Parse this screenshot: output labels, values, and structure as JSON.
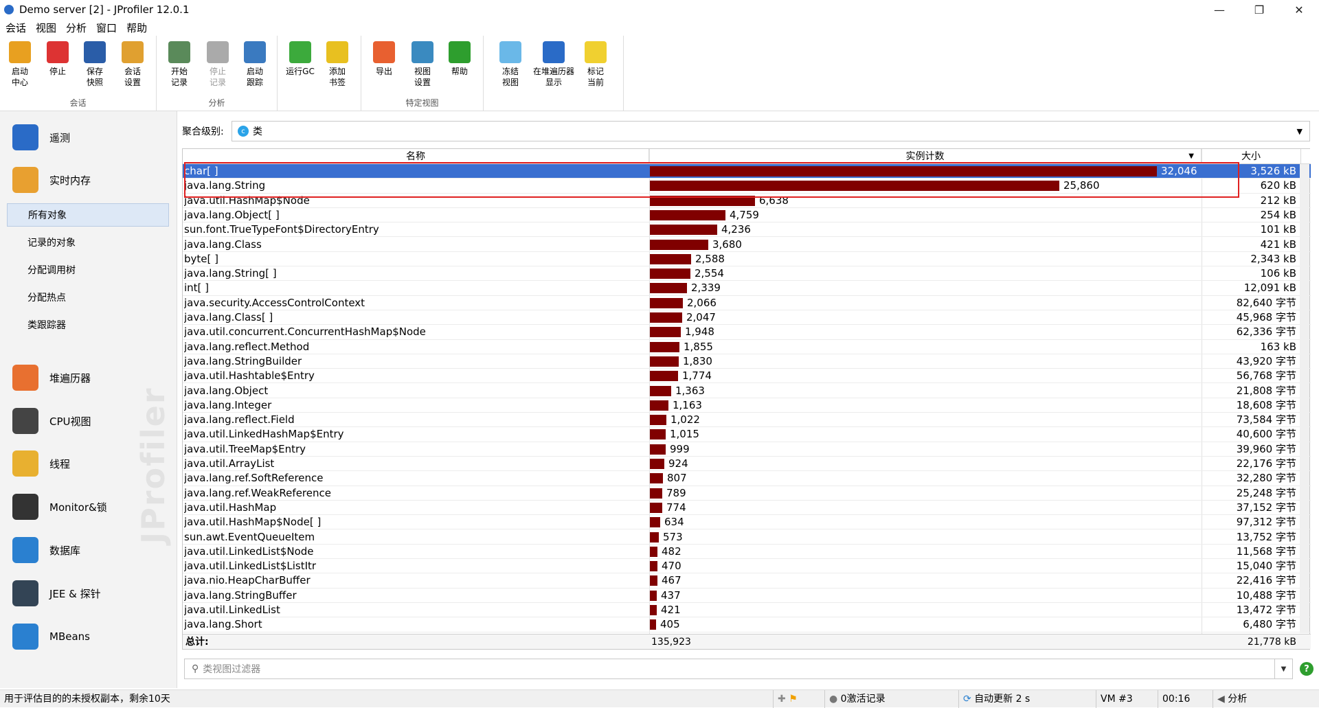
{
  "window": {
    "title": "Demo server [2] - JProfiler 12.0.1"
  },
  "menu": [
    "会话",
    "视图",
    "分析",
    "窗口",
    "帮助"
  ],
  "toolbar": {
    "groups": [
      {
        "label": "会话",
        "buttons": [
          {
            "label": "启动\n中心",
            "icon": "start-center-icon",
            "color": "#e8a020"
          },
          {
            "label": "停止",
            "icon": "stop-icon",
            "color": "#d33"
          },
          {
            "label": "保存\n快照",
            "icon": "save-snapshot-icon",
            "color": "#2a5da8"
          },
          {
            "label": "会话\n设置",
            "icon": "session-settings-icon",
            "color": "#e0a030"
          }
        ]
      },
      {
        "label": "分析",
        "buttons": [
          {
            "label": "开始\n记录",
            "icon": "start-recording-icon",
            "color": "#5a8a5a"
          },
          {
            "label": "停止\n记录",
            "icon": "stop-recording-icon",
            "color": "#aaa"
          },
          {
            "label": "启动\n跟踪",
            "icon": "start-tracking-icon",
            "color": "#3a7ac0"
          }
        ]
      },
      {
        "label": "",
        "buttons": [
          {
            "label": "运行GC",
            "icon": "run-gc-icon",
            "color": "#3caa3c"
          },
          {
            "label": "添加\n书签",
            "icon": "add-bookmark-icon",
            "color": "#e8c020"
          }
        ]
      },
      {
        "label": "特定视图",
        "buttons": [
          {
            "label": "导出",
            "icon": "export-icon",
            "color": "#e86030"
          },
          {
            "label": "视图\n设置",
            "icon": "view-settings-icon",
            "color": "#3a8ac0"
          },
          {
            "label": "帮助",
            "icon": "help-icon",
            "color": "#2e9e2e"
          }
        ]
      },
      {
        "label": "",
        "buttons": [
          {
            "label": "冻结\n视图",
            "icon": "freeze-view-icon",
            "color": "#6ab8e8"
          },
          {
            "label": "在堆遍历器\n显示",
            "icon": "show-in-heap-walker-icon",
            "color": "#2a6bc7"
          },
          {
            "label": "标记\n当前",
            "icon": "mark-current-icon",
            "color": "#f0d030"
          }
        ]
      }
    ]
  },
  "sidebar": {
    "sections": [
      {
        "label": "遥测",
        "icon": "telemetry-icon",
        "color": "#2a6bc7"
      },
      {
        "label": "实时内存",
        "icon": "live-memory-icon",
        "color": "#e8a030"
      },
      {
        "label": "堆遍历器",
        "icon": "heap-walker-icon",
        "color": "#e87030"
      },
      {
        "label": "CPU视图",
        "icon": "cpu-view-icon",
        "color": "#444"
      },
      {
        "label": "线程",
        "icon": "threads-icon",
        "color": "#e8b030"
      },
      {
        "label": "Monitor&锁",
        "icon": "monitor-lock-icon",
        "color": "#333"
      },
      {
        "label": "数据库",
        "icon": "database-icon",
        "color": "#2a80d0"
      },
      {
        "label": "JEE & 探针",
        "icon": "jee-probes-icon",
        "color": "#345"
      },
      {
        "label": "MBeans",
        "icon": "mbeans-icon",
        "color": "#2a80d0"
      }
    ],
    "subitems": [
      "所有对象",
      "记录的对象",
      "分配调用树",
      "分配热点",
      "类跟踪器"
    ],
    "watermark": "JProfiler"
  },
  "aggregation": {
    "label": "聚合级别:",
    "value": "类",
    "icon": "class-icon"
  },
  "table": {
    "columns": [
      "名称",
      "实例计数",
      "大小"
    ],
    "rows": [
      {
        "name": "char[ ]",
        "count": 32046,
        "count_text": "32,046",
        "size": "3,526 kB"
      },
      {
        "name": "java.lang.String",
        "count": 25860,
        "count_text": "25,860",
        "size": "620 kB"
      },
      {
        "name": "java.util.HashMap$Node",
        "count": 6638,
        "count_text": "6,638",
        "size": "212 kB"
      },
      {
        "name": "java.lang.Object[ ]",
        "count": 4759,
        "count_text": "4,759",
        "size": "254 kB"
      },
      {
        "name": "sun.font.TrueTypeFont$DirectoryEntry",
        "count": 4236,
        "count_text": "4,236",
        "size": "101 kB"
      },
      {
        "name": "java.lang.Class",
        "count": 3680,
        "count_text": "3,680",
        "size": "421 kB"
      },
      {
        "name": "byte[ ]",
        "count": 2588,
        "count_text": "2,588",
        "size": "2,343 kB"
      },
      {
        "name": "java.lang.String[ ]",
        "count": 2554,
        "count_text": "2,554",
        "size": "106 kB"
      },
      {
        "name": "int[ ]",
        "count": 2339,
        "count_text": "2,339",
        "size": "12,091 kB"
      },
      {
        "name": "java.security.AccessControlContext",
        "count": 2066,
        "count_text": "2,066",
        "size": "82,640 字节"
      },
      {
        "name": "java.lang.Class[ ]",
        "count": 2047,
        "count_text": "2,047",
        "size": "45,968 字节"
      },
      {
        "name": "java.util.concurrent.ConcurrentHashMap$Node",
        "count": 1948,
        "count_text": "1,948",
        "size": "62,336 字节"
      },
      {
        "name": "java.lang.reflect.Method",
        "count": 1855,
        "count_text": "1,855",
        "size": "163 kB"
      },
      {
        "name": "java.lang.StringBuilder",
        "count": 1830,
        "count_text": "1,830",
        "size": "43,920 字节"
      },
      {
        "name": "java.util.Hashtable$Entry",
        "count": 1774,
        "count_text": "1,774",
        "size": "56,768 字节"
      },
      {
        "name": "java.lang.Object",
        "count": 1363,
        "count_text": "1,363",
        "size": "21,808 字节"
      },
      {
        "name": "java.lang.Integer",
        "count": 1163,
        "count_text": "1,163",
        "size": "18,608 字节"
      },
      {
        "name": "java.lang.reflect.Field",
        "count": 1022,
        "count_text": "1,022",
        "size": "73,584 字节"
      },
      {
        "name": "java.util.LinkedHashMap$Entry",
        "count": 1015,
        "count_text": "1,015",
        "size": "40,600 字节"
      },
      {
        "name": "java.util.TreeMap$Entry",
        "count": 999,
        "count_text": "999",
        "size": "39,960 字节"
      },
      {
        "name": "java.util.ArrayList",
        "count": 924,
        "count_text": "924",
        "size": "22,176 字节"
      },
      {
        "name": "java.lang.ref.SoftReference",
        "count": 807,
        "count_text": "807",
        "size": "32,280 字节"
      },
      {
        "name": "java.lang.ref.WeakReference",
        "count": 789,
        "count_text": "789",
        "size": "25,248 字节"
      },
      {
        "name": "java.util.HashMap",
        "count": 774,
        "count_text": "774",
        "size": "37,152 字节"
      },
      {
        "name": "java.util.HashMap$Node[ ]",
        "count": 634,
        "count_text": "634",
        "size": "97,312 字节"
      },
      {
        "name": "sun.awt.EventQueueItem",
        "count": 573,
        "count_text": "573",
        "size": "13,752 字节"
      },
      {
        "name": "java.util.LinkedList$Node",
        "count": 482,
        "count_text": "482",
        "size": "11,568 字节"
      },
      {
        "name": "java.util.LinkedList$ListItr",
        "count": 470,
        "count_text": "470",
        "size": "15,040 字节"
      },
      {
        "name": "java.nio.HeapCharBuffer",
        "count": 467,
        "count_text": "467",
        "size": "22,416 字节"
      },
      {
        "name": "java.lang.StringBuffer",
        "count": 437,
        "count_text": "437",
        "size": "10,488 字节"
      },
      {
        "name": "java.util.LinkedList",
        "count": 421,
        "count_text": "421",
        "size": "13,472 字节"
      },
      {
        "name": "java.lang.Short",
        "count": 405,
        "count_text": "405",
        "size": "6,480 字节"
      }
    ],
    "total": {
      "label": "总计:",
      "count": "135,923",
      "size": "21,778 kB"
    },
    "selected_row": 0,
    "bar_color": "#800000"
  },
  "filter": {
    "placeholder": "类视图过滤器"
  },
  "statusbar": {
    "license": "用于评估目的的未授权副本，剩余10天",
    "recordings": "0激活记录",
    "auto_update": "自动更新 2 s",
    "vm": "VM #3",
    "time": "00:16",
    "mode": "分析"
  }
}
